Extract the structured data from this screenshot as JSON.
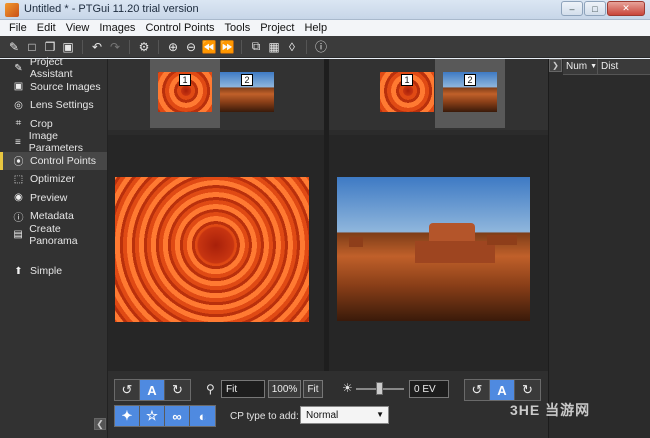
{
  "window": {
    "title": "Untitled * - PTGui 11.20 trial version"
  },
  "menu": [
    "File",
    "Edit",
    "View",
    "Images",
    "Control Points",
    "Tools",
    "Project",
    "Help"
  ],
  "sidebar": {
    "items": [
      {
        "label": "Project Assistant",
        "icon": "assistant-icon",
        "glyph": "✎"
      },
      {
        "label": "Source Images",
        "icon": "image-icon",
        "glyph": "▣"
      },
      {
        "label": "Lens Settings",
        "icon": "lens-icon",
        "glyph": "◎"
      },
      {
        "label": "Crop",
        "icon": "crop-icon",
        "glyph": "⌗"
      },
      {
        "label": "Image Parameters",
        "icon": "sliders-icon",
        "glyph": "≡"
      },
      {
        "label": "Control Points",
        "icon": "control-points-icon",
        "glyph": "⦿",
        "active": true
      },
      {
        "label": "Optimizer",
        "icon": "optimizer-icon",
        "glyph": "⬚"
      },
      {
        "label": "Preview",
        "icon": "eye-icon",
        "glyph": "◉"
      },
      {
        "label": "Metadata",
        "icon": "info-icon",
        "glyph": "ⓘ"
      },
      {
        "label": "Create Panorama",
        "icon": "panorama-icon",
        "glyph": "▤"
      }
    ],
    "simple": {
      "label": "Simple",
      "icon": "simple-icon",
      "glyph": "⬆"
    }
  },
  "panes": {
    "left": {
      "thumbs": [
        "1",
        "2"
      ],
      "selected": "1"
    },
    "right": {
      "thumbs": [
        "1",
        "2"
      ],
      "selected": "2"
    }
  },
  "controls": {
    "zoom_value": "Fit",
    "zoom_100_label": "100%",
    "zoom_fit_label": "Fit",
    "exposure_value": "0 EV",
    "auto_label": "A",
    "cp_type_label": "CP type to add:",
    "cp_type_value": "Normal"
  },
  "right_panel": {
    "columns": [
      "Num",
      "Dist"
    ]
  },
  "watermark": "3HE 当游网",
  "colors": {
    "active_marker": "#e8c640",
    "toggle_on": "#4f8ae0"
  }
}
